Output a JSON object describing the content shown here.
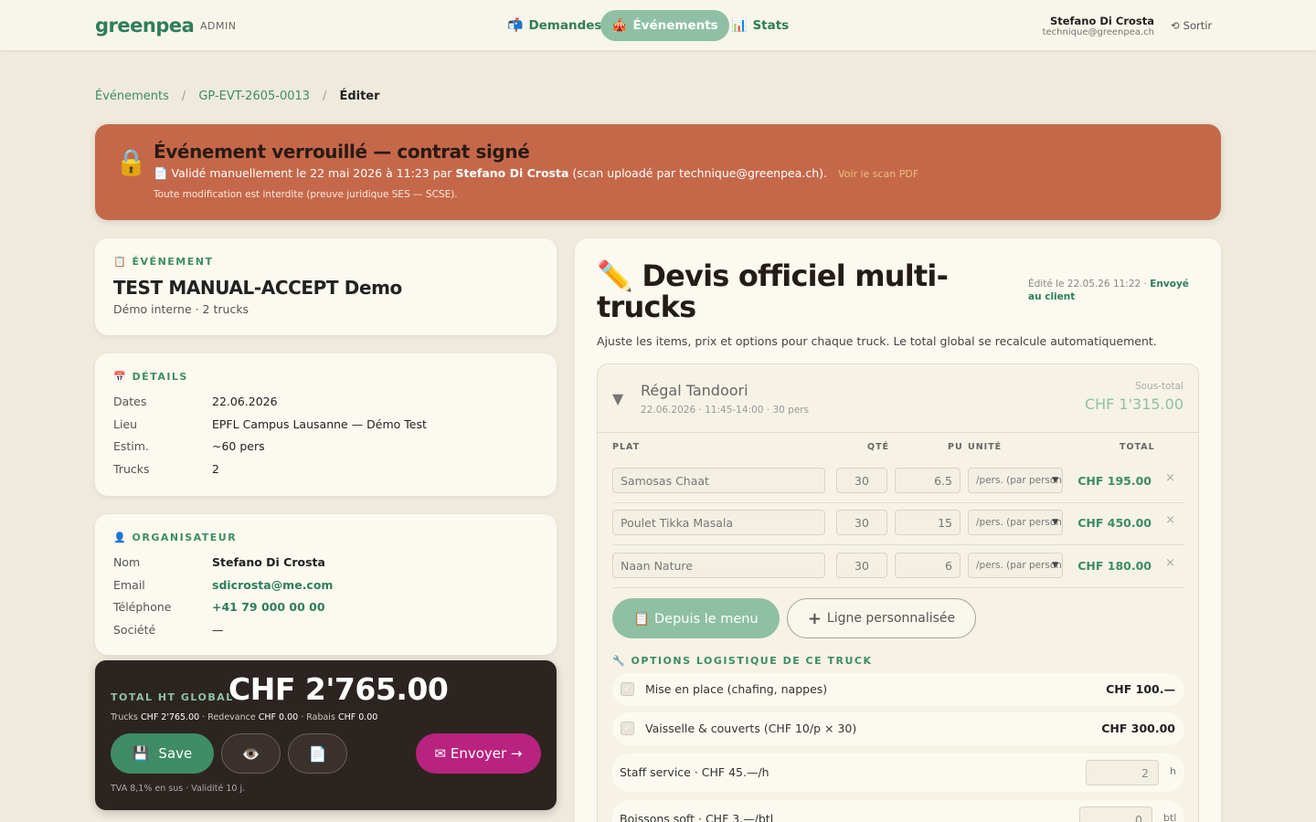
{
  "nav": {
    "brand": "greenpea",
    "brand_tag": "ADMIN",
    "tabs": [
      {
        "icon": "📬",
        "label": "Demandes"
      },
      {
        "icon": "🎪",
        "label": "Événements"
      },
      {
        "icon": "📊",
        "label": "Stats"
      }
    ],
    "user_name": "Stefano Di Crosta",
    "user_email": "technique@greenpea.ch",
    "logout_icon": "⟲",
    "logout_label": "Sortir"
  },
  "breadcrumb": {
    "items": [
      "Événements",
      "GP-EVT-2605-0013",
      "Éditer"
    ],
    "separator": "/"
  },
  "lock_banner": {
    "icon": "🔒",
    "title": "Événement verrouillé — contrat signé",
    "line_prefix": "📄 Validé manuellement le 22 mai 2026 à 11:23 par",
    "line_name": "Stefano Di Crosta",
    "line_suffix": "(scan uploadé par technique@greenpea.ch).",
    "pdf_link": "Voir le scan PDF",
    "note": "Toute modification est interdite (preuve juridique SES — SCSE)."
  },
  "event_card": {
    "label": "📋 ÉVÉNEMENT",
    "title": "TEST MANUAL-ACCEPT Demo",
    "subtitle": "Démo interne · 2 trucks"
  },
  "details_card": {
    "label": "📅 DÉTAILS",
    "rows": [
      {
        "k": "Dates",
        "v": "22.06.2026"
      },
      {
        "k": "Lieu",
        "v": "EPFL Campus Lausanne — Démo Test"
      },
      {
        "k": "Estim.",
        "v": "~60 pers"
      },
      {
        "k": "Trucks",
        "v": "2"
      }
    ]
  },
  "organizer_card": {
    "label": "👤 ORGANISATEUR",
    "rows": [
      {
        "k": "Nom",
        "v": "Stefano Di Crosta"
      },
      {
        "k": "Email",
        "v": "sdicrosta@me.com"
      },
      {
        "k": "Téléphone",
        "v": "+41 79 000 00 00"
      },
      {
        "k": "Société",
        "v": "—"
      }
    ]
  },
  "totals": {
    "label": "TOTAL HT GLOBAL",
    "value": "CHF 2'765.00",
    "trucks_label": "Trucks",
    "trucks_value": "CHF 2'765.00",
    "redevance_label": "· Redevance",
    "redevance_value": "CHF 0.00",
    "rabais_label": "· Rabais",
    "rabais_value": "CHF 0.00",
    "save_icon": "💾",
    "save_label": "Save",
    "preview_icon": "👁️",
    "pdf_icon": "📄",
    "send_label": "✉ Envoyer →",
    "footer": "TVA 8,1% en sus · Validité 10 j."
  },
  "quote": {
    "title": "✏️ Devis officiel multi-trucks",
    "meta_prefix": "Édité le 22.05.26 11:22 ·",
    "meta_status": "Envoyé au client",
    "description": "Ajuste les items, prix et options pour chaque truck. Le total global se recalcule automatiquement.",
    "truck": {
      "toggle": "▼",
      "name": "Régal Tandoori",
      "info": "22.06.2026 · 11:45-14:00 · 30 pers",
      "subtotal_label": "Sous-total",
      "subtotal_value": "CHF 1'315.00",
      "columns": {
        "plat": "PLAT",
        "qte": "QTÉ",
        "pu": "PU",
        "unite": "UNITÉ",
        "total": "TOTAL"
      },
      "items": [
        {
          "name": "Samosas Chaat",
          "qty": "30",
          "pu": "6.5",
          "unit": "/pers. (par personne)",
          "total": "CHF 195.00"
        },
        {
          "name": "Poulet Tikka Masala",
          "qty": "30",
          "pu": "15",
          "unit": "/pers. (par personne)",
          "total": "CHF 450.00"
        },
        {
          "name": "Naan Nature",
          "qty": "30",
          "pu": "6",
          "unit": "/pers. (par personne)",
          "total": "CHF 180.00"
        }
      ],
      "remove_icon": "×",
      "btn_menu": "📋 Depuis le menu",
      "btn_custom_icon": "+",
      "btn_custom": "Ligne personnalisée",
      "options_label": "🔧 OPTIONS LOGISTIQUE DE CE TRUCK",
      "options_checks": [
        {
          "label": "Mise en place (chafing, nappes)",
          "price": "CHF 100.—"
        },
        {
          "label": "Vaisselle & couverts (CHF 10/p × 30)",
          "price": "CHF 300.00"
        }
      ],
      "options_inputs": [
        {
          "label": "Staff service · CHF 45.—/h",
          "value": "2",
          "unit": "h"
        },
        {
          "label": "Boissons soft · CHF 3.—/btl",
          "value": "0",
          "unit": "btl"
        }
      ]
    }
  }
}
